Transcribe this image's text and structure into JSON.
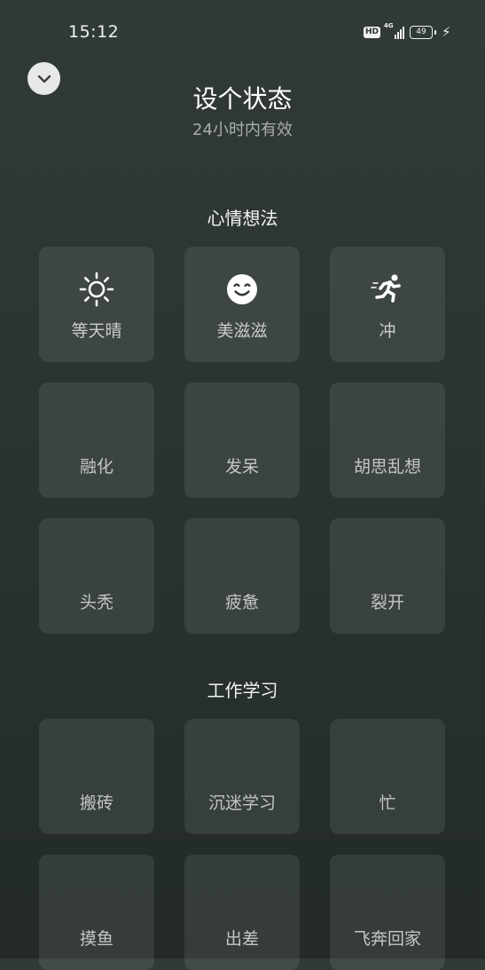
{
  "status_bar": {
    "time": "15:12",
    "hd": "HD",
    "network": "4G",
    "battery": "49"
  },
  "header": {
    "title": "设个状态",
    "subtitle": "24小时内有效"
  },
  "sections": {
    "mood": {
      "title": "心情想法",
      "items": [
        {
          "label": "等天晴",
          "icon": "sun-icon"
        },
        {
          "label": "美滋滋",
          "icon": "smile-icon"
        },
        {
          "label": "冲",
          "icon": "running-icon"
        },
        {
          "label": "融化"
        },
        {
          "label": "发呆"
        },
        {
          "label": "胡思乱想"
        },
        {
          "label": "头秃"
        },
        {
          "label": "疲惫"
        },
        {
          "label": "裂开"
        }
      ]
    },
    "work": {
      "title": "工作学习",
      "items": [
        {
          "label": "搬砖"
        },
        {
          "label": "沉迷学习"
        },
        {
          "label": "忙"
        },
        {
          "label": "摸鱼"
        },
        {
          "label": "出差"
        },
        {
          "label": "飞奔回家"
        }
      ]
    }
  },
  "colors": {
    "background": "#2c3531",
    "tile": "#3e4643",
    "collapse_button": "#e7e9e8"
  }
}
